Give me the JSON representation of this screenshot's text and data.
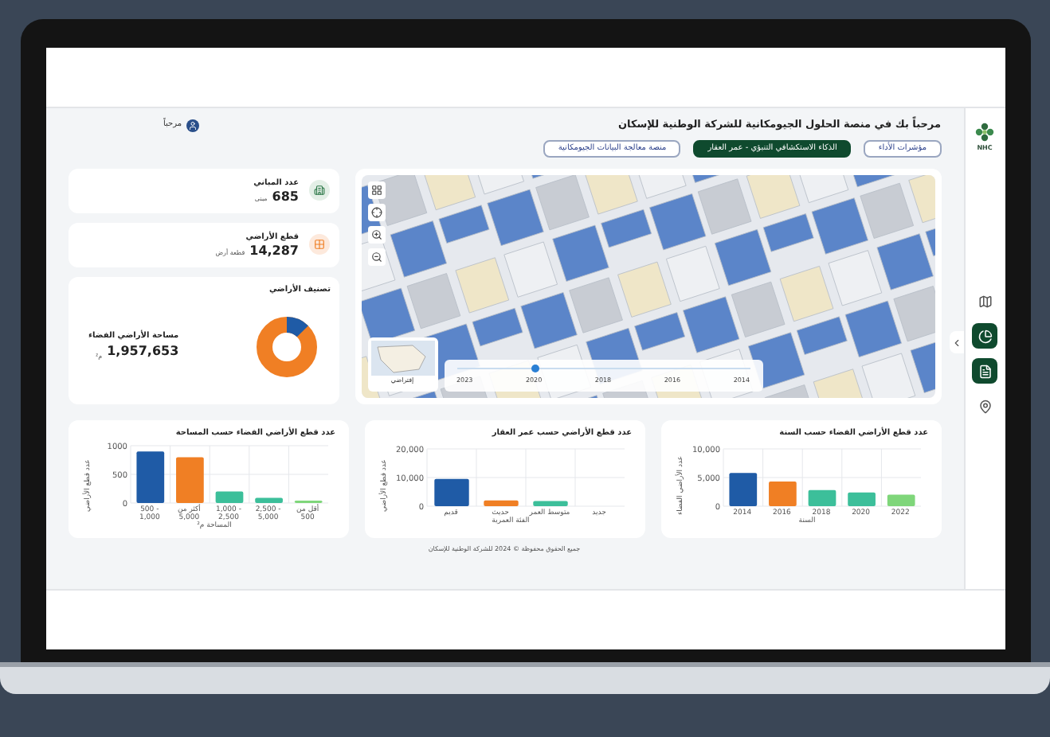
{
  "header": {
    "title": "مرحباً بك في منصة الحلول الجيومكانية للشركة الوطنية للإسكان",
    "user": "مرحباً"
  },
  "logo": {
    "text": "NHC"
  },
  "tabs": [
    {
      "label": "مؤشرات الأداء",
      "selected": false
    },
    {
      "label": "الذكاء الاستكشافي التنبؤي - عمر العقار",
      "selected": true
    },
    {
      "label": "منصة معالجة البيانات الجيومكانية",
      "selected": false
    }
  ],
  "sidebar": {
    "items": [
      {
        "kind": "map",
        "selected": false
      },
      {
        "kind": "chart",
        "selected": true
      },
      {
        "kind": "document",
        "selected": true
      },
      {
        "kind": "pin",
        "selected": false
      }
    ]
  },
  "stats": [
    {
      "label": "عدد المباني",
      "value": "685",
      "unit": "مبنى",
      "kind": "building"
    },
    {
      "label": "قطع الأراضي",
      "value": "14,287",
      "unit": "قطعة أرض",
      "kind": "plot"
    }
  ],
  "land_classification": {
    "title": "تصنيف الأراضي",
    "label": "مساحة الأراضي الفضاء",
    "value": "1,957,653",
    "unit": "م²"
  },
  "map": {
    "basemap": "إفتراضي",
    "timeline": {
      "years": [
        "2014",
        "2016",
        "2018",
        "2020",
        "2023"
      ],
      "level": 0.27
    }
  },
  "charts": [
    {
      "title": "عدد قطع الأراضي الفضاء حسب السنة",
      "chart_data": {
        "type": "bar",
        "ylim": [
          0,
          10000
        ],
        "xlabel": "السنة",
        "ylabel": "عدد الأراضي الفضاء",
        "categories": [
          "2014",
          "2016",
          "2018",
          "2020",
          "2022"
        ],
        "values": [
          5800,
          4300,
          2800,
          2400,
          2000
        ],
        "yticks": [
          {
            "value": 0,
            "label": "0"
          },
          {
            "value": 5000,
            "label": "5,000"
          },
          {
            "value": 10000,
            "label": "10,000"
          }
        ]
      }
    },
    {
      "title": "عدد قطع الأراضي حسب عمر العقار",
      "chart_data": {
        "type": "bar",
        "ylim": [
          0,
          20000
        ],
        "xlabel": "الفئة العمرية",
        "ylabel": "عدد قطع الأراضي",
        "categories": [
          "قديم",
          "حديث",
          "متوسط العمر",
          "جديد"
        ],
        "values": [
          9500,
          2000,
          1800,
          0
        ],
        "yticks": [
          {
            "value": 0,
            "label": "0"
          },
          {
            "value": 10000,
            "label": "10,000"
          },
          {
            "value": 20000,
            "label": "20,000"
          }
        ]
      }
    },
    {
      "title": "عدد قطع الأراضي الفضاء حسب المساحة",
      "chart_data": {
        "type": "bar",
        "ylim": [
          0,
          1000
        ],
        "xlabel": "المساحة م²",
        "ylabel": "عدد قطع الأراضي",
        "categories": [
          "500 - 1,000",
          "أكثر من 5,000",
          "1,000 - 2,500",
          "2,500 - 5,000",
          "أقل من 500"
        ],
        "values": [
          900,
          800,
          200,
          90,
          40
        ],
        "yticks": [
          {
            "value": 0,
            "label": "0"
          },
          {
            "value": 500,
            "label": "500"
          },
          {
            "value": 1000,
            "label": "1000"
          }
        ]
      }
    }
  ],
  "footer": "جميع الحقوق محفوظة © 2024 للشركة الوطنية للإسكان"
}
